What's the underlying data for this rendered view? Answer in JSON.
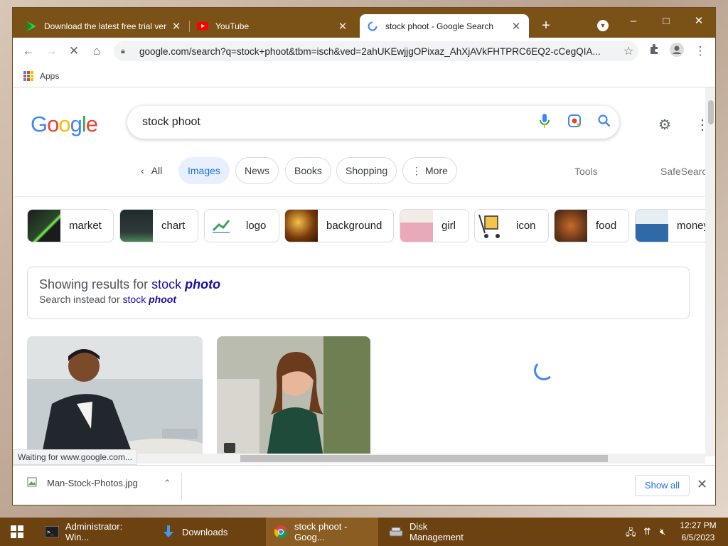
{
  "tabs": [
    {
      "title": "Download the latest free trial ver",
      "icon": "green-play-icon"
    },
    {
      "title": "YouTube",
      "icon": "youtube-icon"
    },
    {
      "title": "stock phoot - Google Search",
      "icon": "google-loading-icon"
    }
  ],
  "window_controls": {
    "minimize": "–",
    "maximize": "□",
    "close": "✕"
  },
  "address_bar": {
    "url": "google.com/search?q=stock+phoot&tbm=isch&ved=2ahUKEwjjgOPixaz_AhXjAVkFHTPRC6EQ2-cCegQIA..."
  },
  "bookmarks": {
    "apps_label": "Apps"
  },
  "google": {
    "logo_letters": [
      "G",
      "o",
      "o",
      "g",
      "l",
      "e"
    ],
    "logo_colors": [
      "#4285F4",
      "#EA4335",
      "#FBBC05",
      "#4285F4",
      "#34A853",
      "#EA4335"
    ],
    "query": "stock phoot"
  },
  "filters": {
    "all": "All",
    "images": "Images",
    "news": "News",
    "books": "Books",
    "shopping": "Shopping",
    "more": "More",
    "tools": "Tools",
    "safesearch": "SafeSearch"
  },
  "related": [
    "market",
    "chart",
    "logo",
    "background",
    "girl",
    "icon",
    "food",
    "money"
  ],
  "correction": {
    "showing_prefix": "Showing results for",
    "showing_plain": "stock",
    "showing_em": "photo",
    "instead_prefix": "Search instead for",
    "instead_plain": "stock",
    "instead_em": "phoot"
  },
  "status": "Waiting for www.google.com...",
  "download": {
    "filename": "Man-Stock-Photos.jpg",
    "show_all": "Show all"
  },
  "taskbar": {
    "items": [
      "Administrator: Win...",
      "Downloads",
      "stock phoot - Goog...",
      "Disk Management"
    ],
    "time": "12:27 PM",
    "date": "6/5/2023"
  },
  "colors": {
    "accent": "#1a73e8",
    "chrome_frame": "#7a5217",
    "taskbar": "#6b4210"
  }
}
